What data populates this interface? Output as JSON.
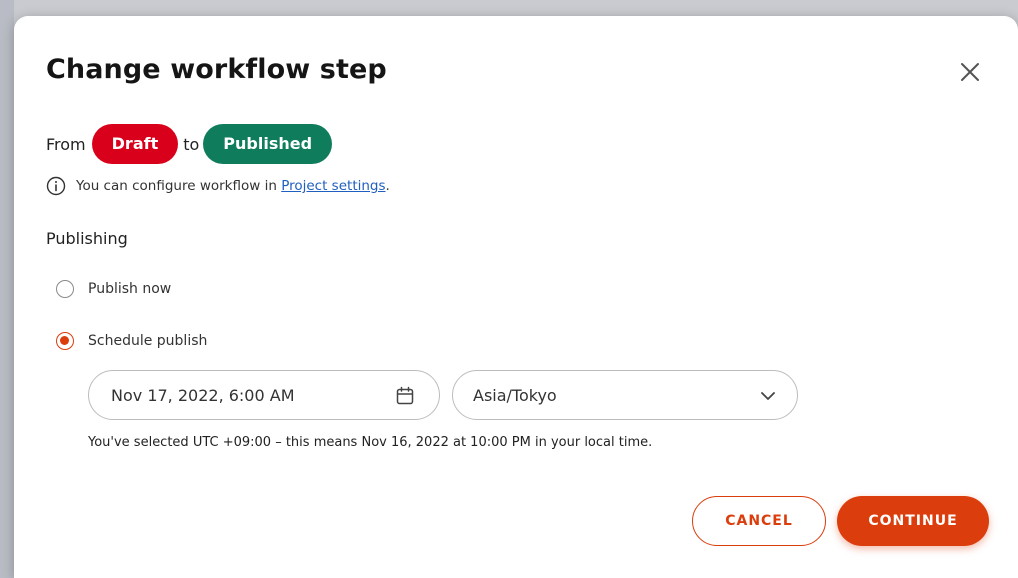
{
  "dialog": {
    "title": "Change workflow step",
    "from_label": "From",
    "from_state": "Draft",
    "to_label": "to",
    "to_state": "Published",
    "info_text": "You can configure workflow in ",
    "info_link": "Project settings",
    "info_suffix": ".",
    "section_label": "Publishing",
    "options": [
      {
        "label": "Publish now",
        "checked": false
      },
      {
        "label": "Schedule publish",
        "checked": true
      }
    ],
    "date_value": "Nov 17, 2022, 6:00 AM",
    "timezone_value": "Asia/Tokyo",
    "hint": "You've selected UTC +09:00 – this means Nov 16, 2022 at 10:00 PM in your local time.",
    "cancel_label": "CANCEL",
    "continue_label": "CONTINUE"
  },
  "colors": {
    "accent": "#db3d0c",
    "draft": "#d9001b",
    "published": "#0f7d5c",
    "link": "#1f5fbf"
  },
  "icons": {
    "close": "close-icon",
    "info": "info-icon",
    "calendar": "calendar-icon",
    "chevron": "chevron-down-icon"
  }
}
